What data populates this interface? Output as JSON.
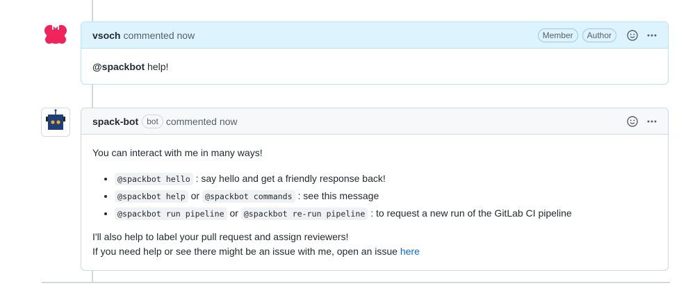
{
  "comments": [
    {
      "author": "vsoch",
      "action": "commented now",
      "badges": [
        "Member",
        "Author"
      ],
      "body": {
        "mention": "@spackbot",
        "text": "help!"
      }
    },
    {
      "author": "spack-bot",
      "bot_label": "bot",
      "action": "commented now",
      "body": {
        "intro": "You can interact with me in many ways!",
        "items": [
          {
            "code1": "@spackbot hello",
            "text": ": say hello and get a friendly response back!"
          },
          {
            "code1": "@spackbot help",
            "or": "or",
            "code2": "@spackbot commands",
            "text": ": see this message"
          },
          {
            "code1": "@spackbot run pipeline",
            "or": "or",
            "code2": "@spackbot re-run pipeline",
            "text": ": to request a new run of the GitLab CI pipeline"
          }
        ],
        "footer_line1": "I'll also help to label your pull request and assign reviewers!",
        "footer_line2": "If you need help or see there might be an issue with me, open an issue",
        "footer_link": "here"
      }
    }
  ],
  "icons": {
    "reaction": "smiley-icon",
    "more": "kebab-horizontal-icon"
  },
  "colors": {
    "author_header_bg": "#ddf4ff",
    "author_border": "#b6e3ff",
    "link": "#0969da",
    "vsoch_avatar": "#f0245a",
    "bot_avatar": "#1f3f7a",
    "bot_eyes": "#f5a623"
  }
}
